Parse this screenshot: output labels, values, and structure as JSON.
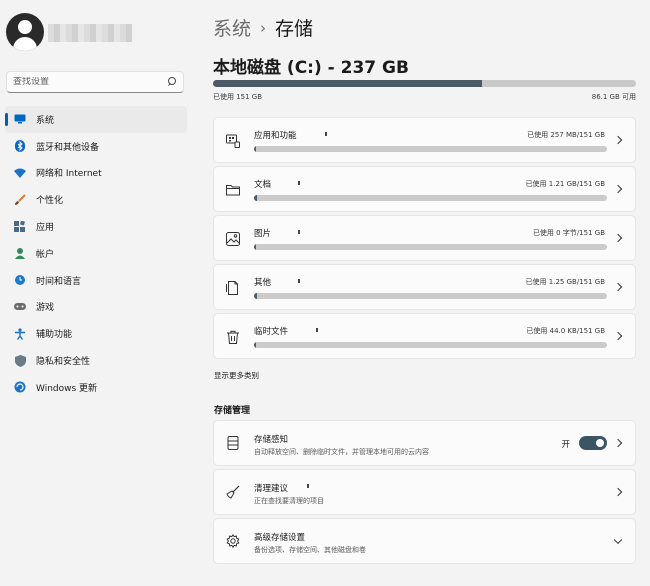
{
  "sidebar": {
    "search_placeholder": "查找设置",
    "items": [
      {
        "label": "系统",
        "icon": "monitor-icon",
        "color": "#0067c0",
        "active": true
      },
      {
        "label": "蓝牙和其他设备",
        "icon": "bluetooth-icon",
        "color": "#0a66c8"
      },
      {
        "label": "网络和 Internet",
        "icon": "wifi-icon",
        "color": "#1a73c9"
      },
      {
        "label": "个性化",
        "icon": "brush-icon",
        "color": "#d9822b"
      },
      {
        "label": "应用",
        "icon": "apps-icon",
        "color": "#4a6a85"
      },
      {
        "label": "帐户",
        "icon": "account-icon",
        "color": "#2e8b57"
      },
      {
        "label": "时间和语言",
        "icon": "globe-clock-icon",
        "color": "#1f7ac7"
      },
      {
        "label": "游戏",
        "icon": "gamepad-icon",
        "color": "#6b6b6b"
      },
      {
        "label": "辅助功能",
        "icon": "accessibility-icon",
        "color": "#1f6fc2"
      },
      {
        "label": "隐私和安全性",
        "icon": "shield-icon",
        "color": "#6a7a86"
      },
      {
        "label": "Windows 更新",
        "icon": "update-icon",
        "color": "#1a73c9"
      }
    ]
  },
  "breadcrumb": {
    "parent": "系统",
    "separator": "›",
    "current": "存储"
  },
  "disk": {
    "title": "本地磁盘 (C:) - 237 GB",
    "used_label": "已使用 151 GB",
    "free_label": "86.1 GB 可用",
    "used_fraction": 0.637
  },
  "categories": [
    {
      "name": "应用和功能",
      "icon": "apps-features-icon",
      "used": "已使用 257 MB/151 GB",
      "fraction": 0.003
    },
    {
      "name": "文档",
      "icon": "folder-icon",
      "used": "已使用 1.21 GB/151 GB",
      "fraction": 0.008
    },
    {
      "name": "图片",
      "icon": "picture-icon",
      "used": "已使用 0 字节/151 GB",
      "fraction": 0
    },
    {
      "name": "其他",
      "icon": "other-files-icon",
      "used": "已使用 1.25 GB/151 GB",
      "fraction": 0.008
    },
    {
      "name": "临时文件",
      "icon": "trash-icon",
      "used": "已使用 44.0 KB/151 GB",
      "fraction": 0
    }
  ],
  "more_link": "显示更多类别",
  "management": {
    "title": "存储管理",
    "items": [
      {
        "title": "存储感知",
        "subtitle": "自动释放空间、删除临时文件，并管理本地可用的云内容",
        "icon": "storage-sense-icon",
        "toggle_label": "开",
        "toggle_on": true
      },
      {
        "title": "清理建议",
        "subtitle": "正在查找要清理的项目",
        "icon": "broom-icon"
      },
      {
        "title": "高级存储设置",
        "subtitle": "备份选项、存储空间、其他磁盘和卷",
        "icon": "gear-icon"
      }
    ]
  }
}
